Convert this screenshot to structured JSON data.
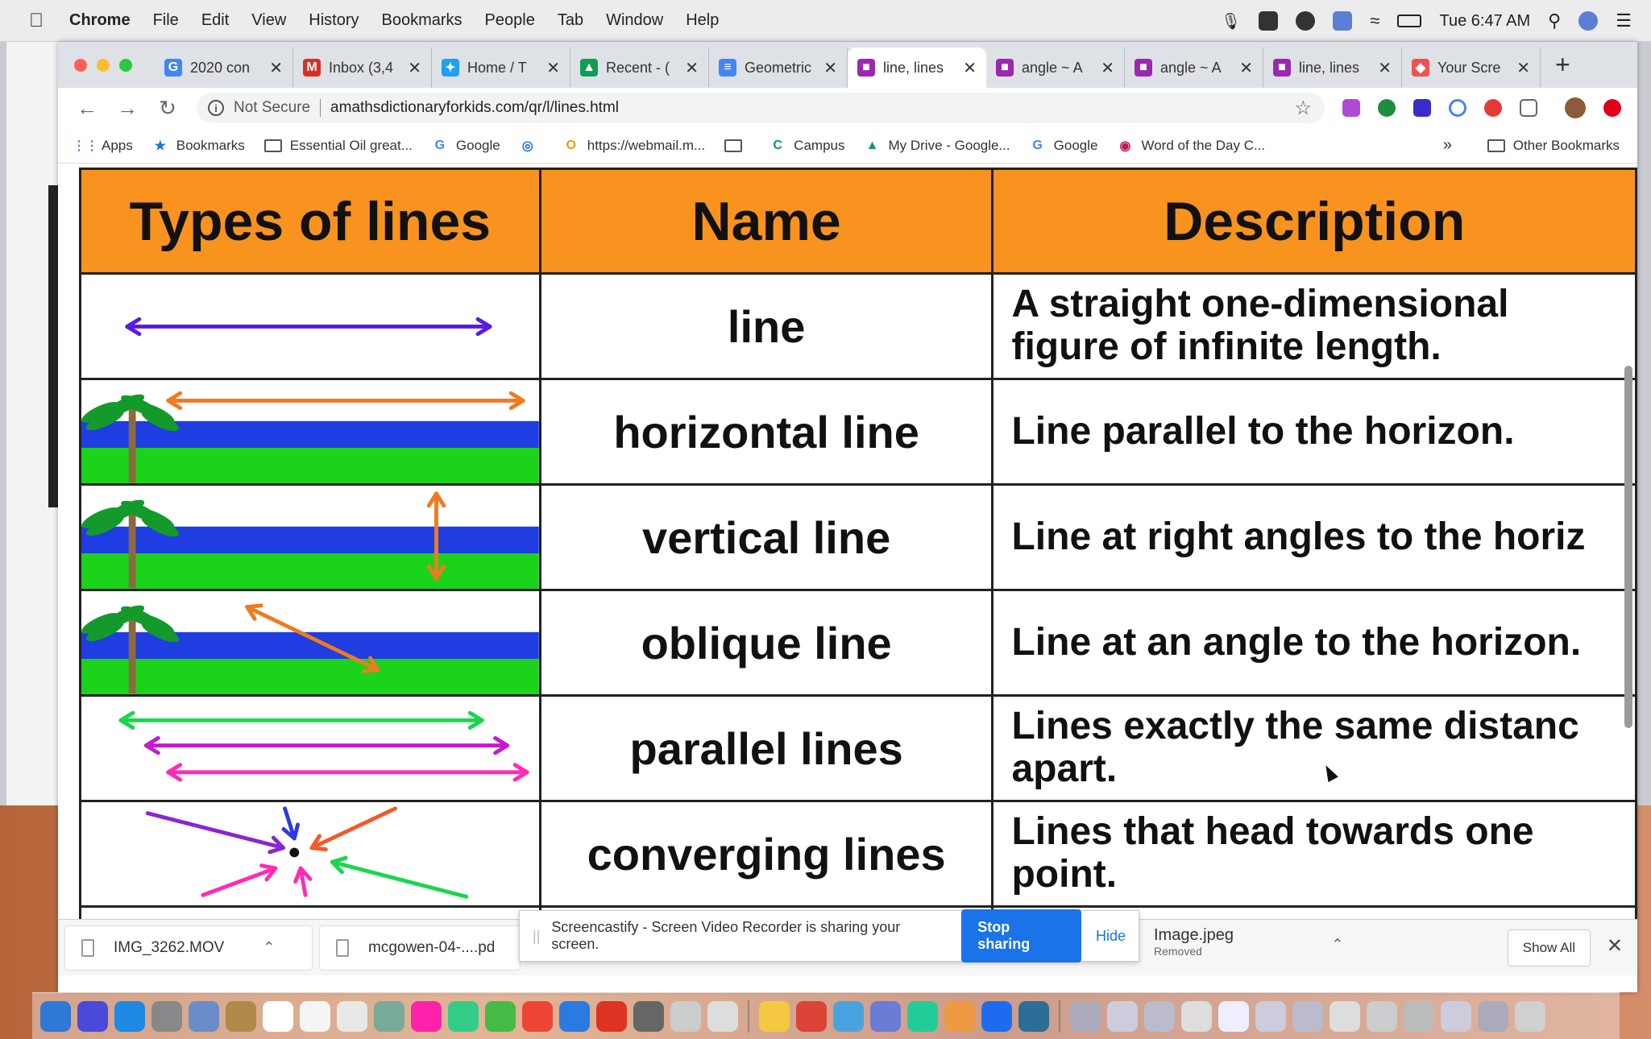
{
  "menubar": {
    "app": "Chrome",
    "items": [
      "File",
      "Edit",
      "View",
      "History",
      "Bookmarks",
      "People",
      "Tab",
      "Window",
      "Help"
    ],
    "clock": "Tue 6:47 AM"
  },
  "tabs": [
    {
      "title": "2020 con",
      "favicon": "google",
      "color": "#4285f4",
      "glyph": "G"
    },
    {
      "title": "Inbox (3,4",
      "favicon": "gmail",
      "color": "#d93025",
      "glyph": "M"
    },
    {
      "title": "Home / T",
      "favicon": "twitter",
      "color": "#1da1f2",
      "glyph": "✦"
    },
    {
      "title": "Recent - (",
      "favicon": "drive",
      "color": "#0f9d58",
      "glyph": "▲"
    },
    {
      "title": "Geometric",
      "favicon": "docs",
      "color": "#4285f4",
      "glyph": "≡"
    },
    {
      "title": "line, lines",
      "favicon": "amathsdictionary",
      "color": "#9c27b0",
      "glyph": "■"
    },
    {
      "title": "angle ~ A",
      "favicon": "amathsdictionary",
      "color": "#9c27b0",
      "glyph": "■"
    },
    {
      "title": "angle ~ A",
      "favicon": "amathsdictionary",
      "color": "#9c27b0",
      "glyph": "■"
    },
    {
      "title": "line, lines",
      "favicon": "amathsdictionary",
      "color": "#9c27b0",
      "glyph": "■"
    },
    {
      "title": "Your Scre",
      "favicon": "screencastify",
      "color": "#ef5350",
      "glyph": "◆"
    }
  ],
  "active_tab": 5,
  "address": {
    "security": "Not Secure",
    "url": "amathsdictionaryforkids.com/qr/l/lines.html"
  },
  "bookmarks": [
    {
      "label": "Apps",
      "icon": "apps-grid-icon"
    },
    {
      "label": "Bookmarks",
      "icon": "star-icon"
    },
    {
      "label": "Essential Oil great...",
      "icon": "folder-icon"
    },
    {
      "label": "Google",
      "icon": "google-icon"
    },
    {
      "label": "",
      "icon": "safari-icon"
    },
    {
      "label": "https://webmail.m...",
      "icon": "webmail-icon"
    },
    {
      "label": "",
      "icon": "folder-icon"
    },
    {
      "label": "Campus",
      "icon": "campus-icon"
    },
    {
      "label": "My Drive - Google...",
      "icon": "drive-icon"
    },
    {
      "label": "Google",
      "icon": "google-icon"
    },
    {
      "label": "Word of the Day C...",
      "icon": "word-of-day-icon"
    }
  ],
  "bookmarks_overflow": "»",
  "other_bookmarks": "Other Bookmarks",
  "table": {
    "headers": [
      "Types of lines",
      "Name",
      "Description"
    ],
    "header_color": "#f7931e",
    "rows": [
      {
        "name": "line",
        "desc1": "A straight one-dimensional",
        "desc2": "figure of infinite length.",
        "picture": "double-arrow"
      },
      {
        "name": "horizontal line",
        "desc1": "Line parallel to the horizon.",
        "desc2": "",
        "picture": "horizontal"
      },
      {
        "name": "vertical line",
        "desc1": "Line at right angles to the horiz",
        "desc2": "",
        "picture": "vertical"
      },
      {
        "name": "oblique  line",
        "desc1": "Line at an angle to the horizon.",
        "desc2": "",
        "picture": "oblique"
      },
      {
        "name": "parallel lines",
        "desc1": "Lines exactly the same distanc",
        "desc2": "apart.",
        "picture": "parallel"
      },
      {
        "name": "converging lines",
        "desc1": "Lines that head towards one",
        "desc2": "point.",
        "picture": "converging"
      }
    ]
  },
  "downloads": {
    "items": [
      {
        "name": "IMG_3262.MOV"
      },
      {
        "name": "mcgowen-04-....pd"
      }
    ],
    "image_item": {
      "name": "Image.jpeg",
      "status": "Removed"
    },
    "show_all": "Show All"
  },
  "share_banner": {
    "text": "Screencastify - Screen Video Recorder is sharing your screen.",
    "stop": "Stop sharing",
    "hide": "Hide"
  }
}
